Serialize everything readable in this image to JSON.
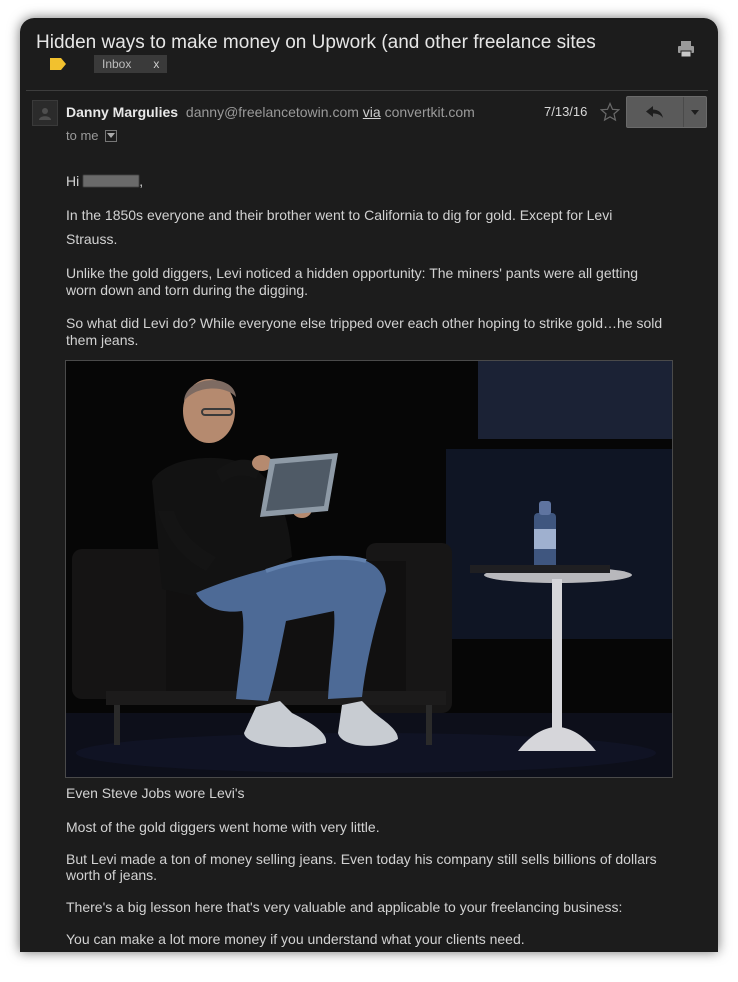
{
  "email": {
    "subject": "Hidden ways to make money on Upwork (and other freelance sites",
    "label_chip": {
      "label": "Inbox",
      "remove": "x"
    },
    "sender": {
      "name": "Danny Margulies",
      "email": "danny@freelancetowin.com",
      "via_word": "via",
      "via_domain": "convertkit.com"
    },
    "recipient": "to me",
    "date": "7/13/16",
    "icons": {
      "print": "print-icon",
      "label": "label-tag-icon",
      "star": "star-icon",
      "reply": "reply-icon",
      "more": "caret-down-icon",
      "avatar": "person-icon"
    }
  },
  "body": {
    "greeting_prefix": "Hi",
    "greeting_suffix": ",",
    "p1_line1": "In the 1850s everyone and their brother went to California to dig for gold. Except for Levi",
    "p1_line2": "Strauss.",
    "p2_line1": "Unlike the gold diggers, Levi noticed a hidden opportunity: The miners' pants were all getting",
    "p2_line2": "worn down and torn during the digging.",
    "p3_line1": "So what did Levi do? While everyone else tripped over each other hoping to strike gold…he sold",
    "p3_line2": "them jeans.",
    "caption": "Even Steve Jobs wore Levi's",
    "p4": "Most of the gold diggers went home with very little.",
    "p5_line1": "But Levi made a ton of money selling jeans. Even today his company still sells billions of dollars",
    "p5_line2": "worth of jeans.",
    "p6": "There's a big lesson here that's very valuable and applicable to your freelancing business:",
    "p7": "You can make a lot more money if you understand what your clients need."
  },
  "colors": {
    "background": "#1c1c1c",
    "text": "#d2d2d2",
    "label_tag": "#f2c12e"
  }
}
